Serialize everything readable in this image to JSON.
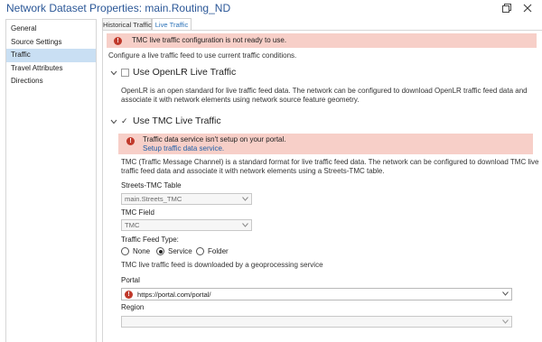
{
  "window": {
    "title": "Network Dataset Properties: main.Routing_ND",
    "restore_icon": "restore-window-icon",
    "close_icon": "close-icon"
  },
  "sidebar": {
    "items": [
      {
        "label": "General"
      },
      {
        "label": "Source Settings"
      },
      {
        "label": "Traffic",
        "selected": true
      },
      {
        "label": "Travel Attributes"
      },
      {
        "label": "Directions"
      }
    ]
  },
  "tabs": [
    {
      "label": "Historical Traffic"
    },
    {
      "label": "Live Traffic",
      "active": true
    }
  ],
  "top_banner": {
    "message": "TMC live traffic configuration is not ready to use.",
    "icon": "error-icon",
    "color": "#f7cfc8"
  },
  "intro": "Configure a live traffic feed to use current traffic conditions.",
  "openlr": {
    "title": "Use OpenLR Live Traffic",
    "checked": false,
    "description_line1": "OpenLR is an open standard for live traffic feed data. The network can be configured to download OpenLR traffic feed data and",
    "description_line2": "associate it with network elements using network source feature geometry."
  },
  "tmc": {
    "title": "Use TMC Live Traffic",
    "checked": true,
    "banner": {
      "message": "Traffic data service isn't setup on your portal.",
      "link": "Setup traffic data service."
    },
    "description_line1": "TMC (Traffic Message Channel) is a standard format for live traffic feed data. The network can be configured to download TMC live",
    "description_line2": "traffic feed data and associate it with network elements using a Streets-TMC table.",
    "streets_table": {
      "label": "Streets-TMC Table",
      "value": "main.Streets_TMC"
    },
    "tmc_field": {
      "label": "TMC Field",
      "value": "TMC"
    },
    "feed_type": {
      "label": "Traffic Feed Type:",
      "options": [
        "None",
        "Service",
        "Folder"
      ],
      "selected": "Service"
    },
    "feed_note": "TMC live traffic feed is downloaded by a geoprocessing service",
    "portal": {
      "label": "Portal",
      "value": "https://portal.com/portal/"
    },
    "region": {
      "label": "Region",
      "value": ""
    }
  }
}
